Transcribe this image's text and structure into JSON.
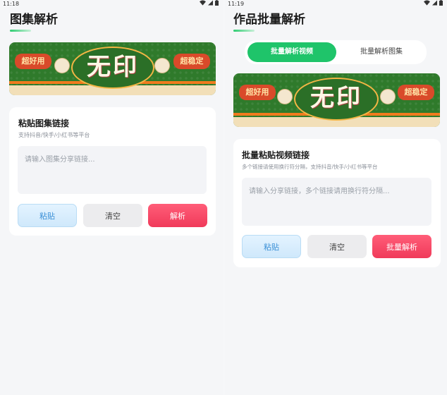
{
  "left": {
    "status_time": "11:18",
    "title": "图集解析",
    "banner": {
      "tag_left": "超好用",
      "tag_right": "超稳定",
      "center_text": "无印"
    },
    "card": {
      "title": "粘贴图集链接",
      "subtitle": "支持抖音/快手/小红书等平台",
      "placeholder": "请输入图集分享链接..."
    },
    "buttons": {
      "paste": "粘贴",
      "clear": "清空",
      "parse": "解析"
    }
  },
  "right": {
    "status_time": "11:19",
    "title": "作品批量解析",
    "tabs": [
      {
        "label": "批量解析视频",
        "active": true
      },
      {
        "label": "批量解析图集",
        "active": false
      }
    ],
    "banner": {
      "tag_left": "超好用",
      "tag_right": "超稳定",
      "center_text": "无印"
    },
    "card": {
      "title": "批量粘贴视频链接",
      "subtitle": "多个链接请使用换行符分隔，支持抖音/快手/小红书等平台",
      "placeholder": "请输入分享链接，多个链接请用换行符分隔..."
    },
    "buttons": {
      "paste": "粘贴",
      "clear": "清空",
      "parse": "批量解析"
    }
  },
  "colors": {
    "accent_green": "#1fc46a",
    "parse_red": "#f03a5a",
    "paste_blue": "#3a8fd6",
    "banner_green": "#2f7a2b"
  }
}
